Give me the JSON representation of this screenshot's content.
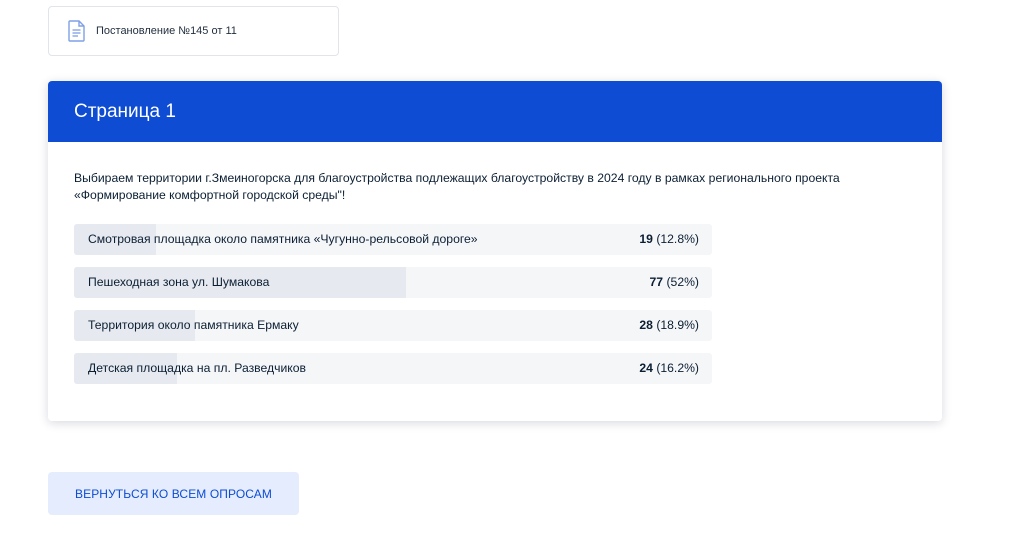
{
  "document": {
    "icon": "document-icon",
    "label": "Постановление №145 от 11"
  },
  "card": {
    "title": "Страница 1",
    "question": "Выбираем территории г.Змеиногорска для благоустройства подлежащих благоустройству в 2024 году в рамках регионального проекта «Формирование комфортной городской среды\"!",
    "answers": [
      {
        "text": "Смотровая площадка около памятника «Чугунно-рельсовой дороге»",
        "count": "19",
        "percent": "(12.8%)",
        "fraction": 0.128
      },
      {
        "text": "Пешеходная зона ул. Шумакова",
        "count": "77",
        "percent": "(52%)",
        "fraction": 0.52
      },
      {
        "text": "Территория около памятника Ермаку",
        "count": "28",
        "percent": "(18.9%)",
        "fraction": 0.189
      },
      {
        "text": "Детская площадка на пл. Разведчиков",
        "count": "24",
        "percent": "(16.2%)",
        "fraction": 0.162
      }
    ]
  },
  "back_button": {
    "label": "ВЕРНУТЬСЯ КО ВСЕМ ОПРОСАМ"
  },
  "colors": {
    "accent": "#0d4cd3",
    "button_bg": "#e4ecfd",
    "bar_fill": "#e6e9ef",
    "bar_track": "#f5f6f8"
  }
}
